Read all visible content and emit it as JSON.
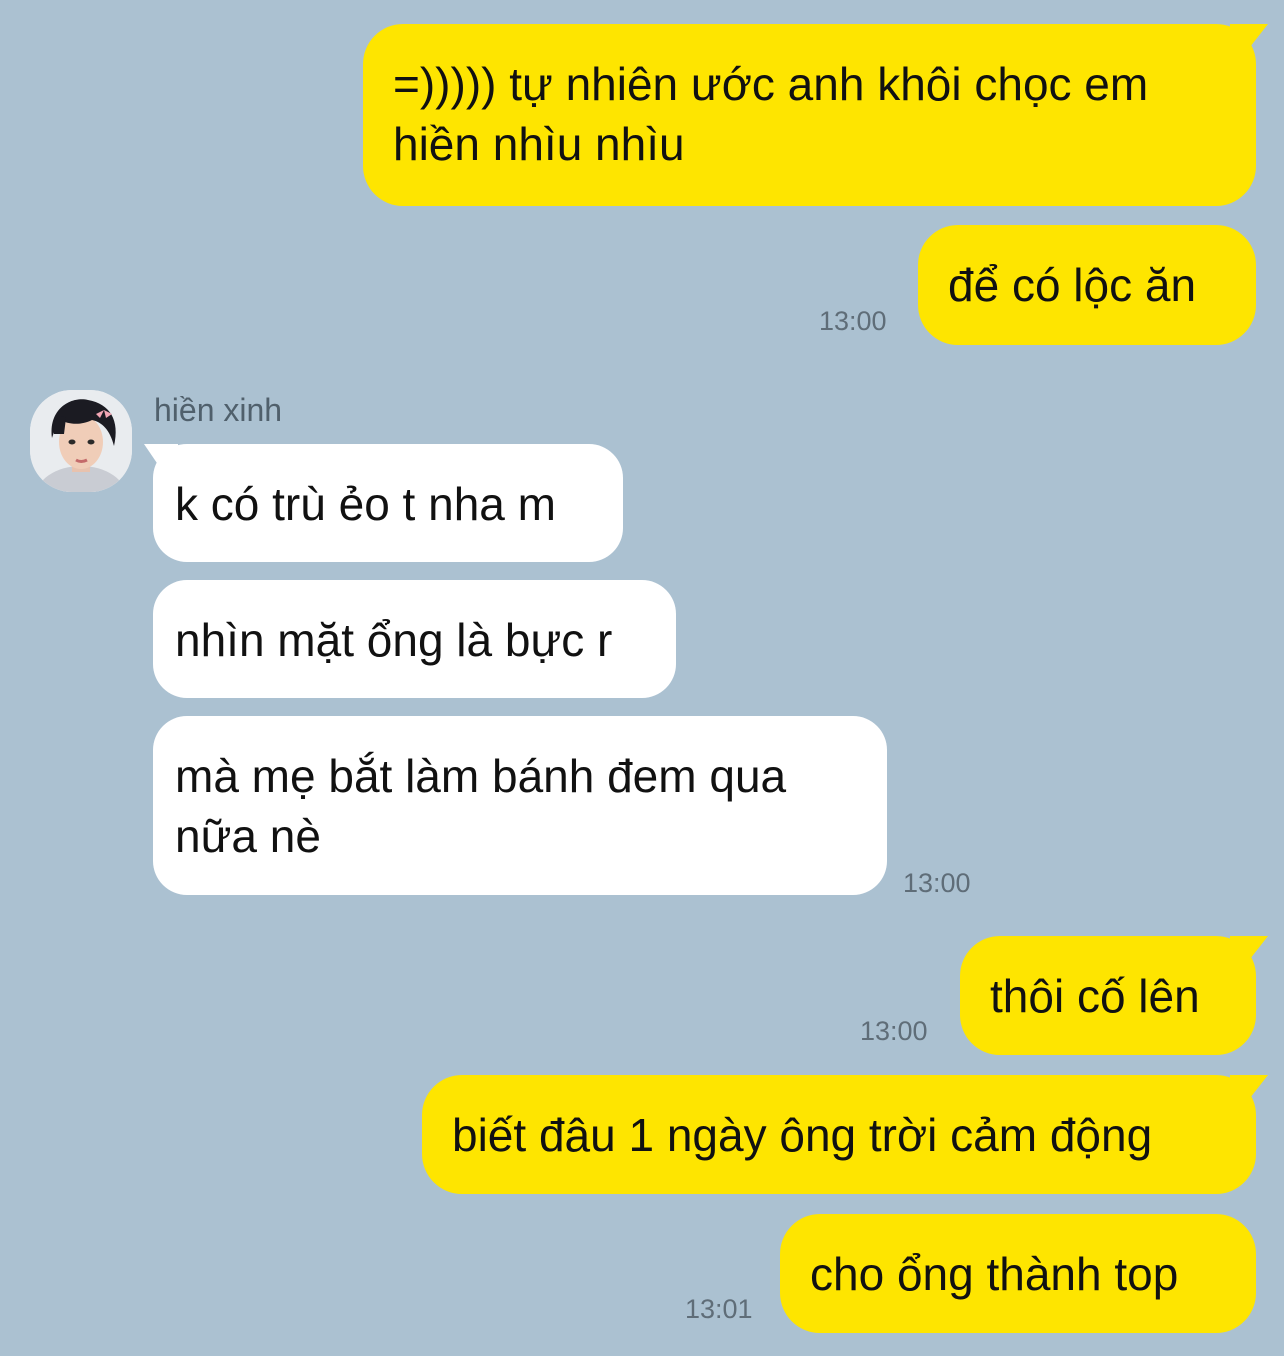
{
  "chat": {
    "messages": [
      {
        "side": "me",
        "text": "=))))) tự nhiên ước anh khôi chọc em hiền nhìu nhìu"
      },
      {
        "side": "me",
        "text": "để có lộc ăn",
        "time": "13:00"
      },
      {
        "side": "them",
        "sender": "hiền xinh",
        "text": "k có trù ẻo t nha m"
      },
      {
        "side": "them",
        "text": "nhìn mặt ổng là bực r"
      },
      {
        "side": "them",
        "text": "mà mẹ bắt làm bánh đem qua nữa nè",
        "time": "13:00"
      },
      {
        "side": "me",
        "text": "thôi cố lên",
        "time": "13:00"
      },
      {
        "side": "me",
        "text": "biết đâu 1 ngày ông trời cảm động"
      },
      {
        "side": "me",
        "text": "cho ổng thành top",
        "time": "13:01"
      }
    ]
  },
  "contact": {
    "name": "hiền xinh",
    "avatar_icon": "profile-photo"
  },
  "colors": {
    "background": "#abc1d1",
    "my_bubble": "#fee500",
    "their_bubble": "#ffffff",
    "timestamp": "#5f6d78"
  }
}
